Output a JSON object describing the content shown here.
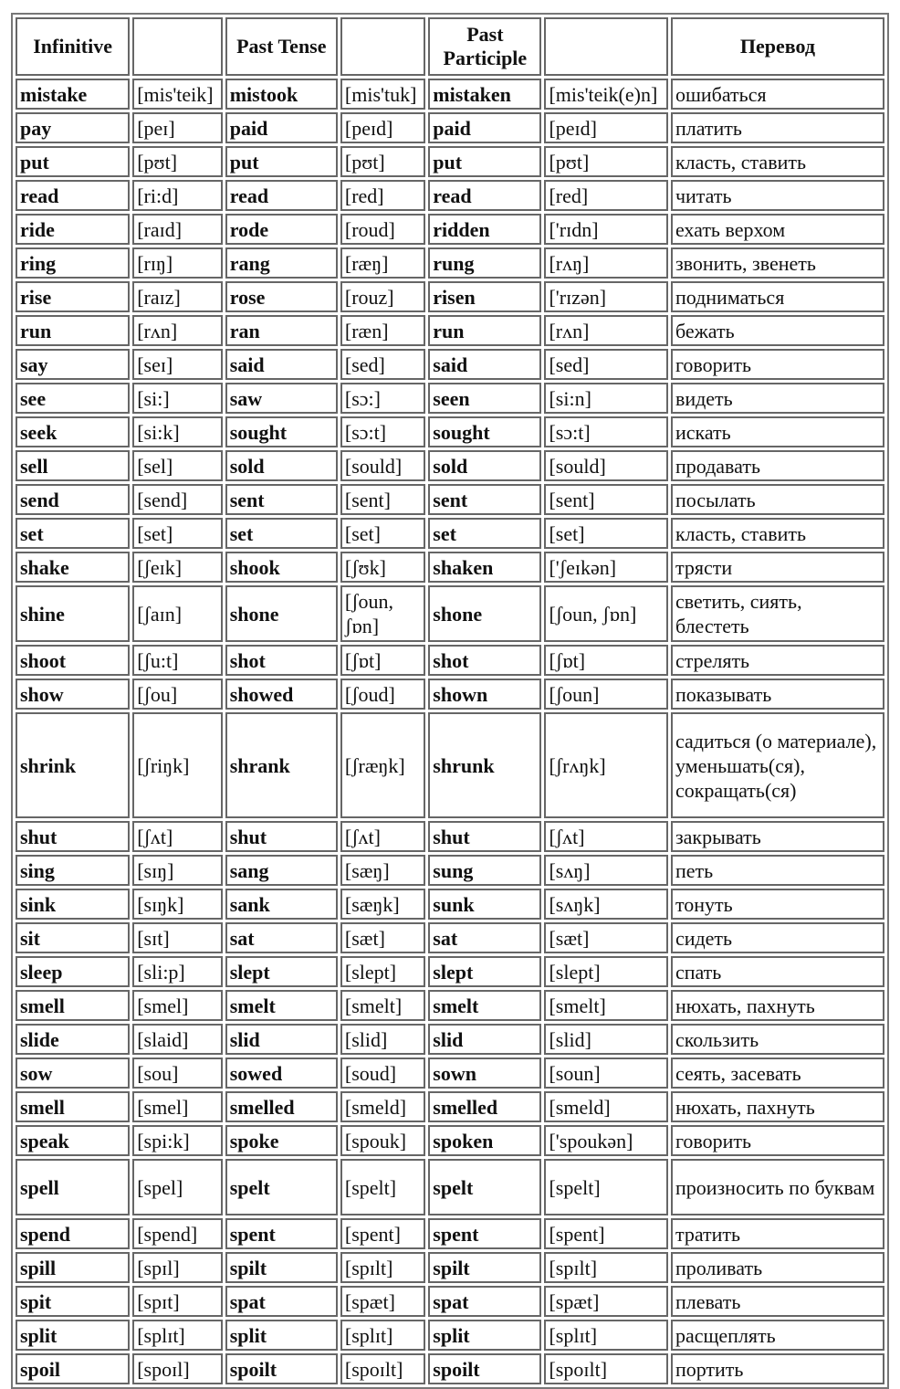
{
  "headers": [
    "Infinitive",
    "",
    "Past Tense",
    "",
    "Past Participle",
    "",
    "Перевод"
  ],
  "rows": [
    [
      "mistake",
      "[mis'teik]",
      "mistook",
      "[mis'tuk]",
      "mistaken",
      "[mis'teik(e)n]",
      "ошибаться"
    ],
    [
      "pay",
      "[peɪ]",
      "paid",
      "[peɪd]",
      "paid",
      "[peɪd]",
      "платить"
    ],
    [
      "put",
      "[pʊt]",
      "put",
      "[pʊt]",
      "put",
      "[pʊt]",
      "класть, ставить"
    ],
    [
      "read",
      "[ri:d]",
      "read",
      "[red]",
      "read",
      "[red]",
      "читать"
    ],
    [
      "ride",
      "[raɪd]",
      "rode",
      "[roud]",
      "ridden",
      "['rɪdn]",
      "ехать верхом"
    ],
    [
      "ring",
      "[rɪŋ]",
      "rang",
      "[ræŋ]",
      "rung",
      "[rʌŋ]",
      "звонить, звенеть"
    ],
    [
      "rise",
      "[raɪz]",
      "rose",
      "[rouz]",
      "risen",
      "['rɪzən]",
      "подниматься"
    ],
    [
      "run",
      "[rʌn]",
      "ran",
      "[ræn]",
      "run",
      "[rʌn]",
      "бежать"
    ],
    [
      "say",
      "[seɪ]",
      "said",
      "[sed]",
      "said",
      "[sed]",
      "говорить"
    ],
    [
      "see",
      "[si:]",
      "saw",
      "[sɔ:]",
      "seen",
      "[si:n]",
      "видеть"
    ],
    [
      "seek",
      "[si:k]",
      "sought",
      "[sɔ:t]",
      "sought",
      "[sɔ:t]",
      "искать"
    ],
    [
      "sell",
      "[sel]",
      "sold",
      "[sould]",
      "sold",
      "[sould]",
      "продавать"
    ],
    [
      "send",
      "[send]",
      "sent",
      "[sent]",
      "sent",
      "[sent]",
      "посылать"
    ],
    [
      "set",
      "[set]",
      "set",
      "[set]",
      "set",
      "[set]",
      "класть, ставить"
    ],
    [
      "shake",
      "[ʃeɪk]",
      "shook",
      "[ʃʊk]",
      "shaken",
      "['ʃeɪkən]",
      "трясти"
    ],
    [
      "shine",
      "[ʃaɪn]",
      "shone",
      "[ʃoun, ʃɒn]",
      "shone",
      "[ʃoun, ʃɒn]",
      "светить, сиять, блестеть"
    ],
    [
      "shoot",
      "[ʃu:t]",
      "shot",
      "[ʃɒt]",
      "shot",
      "[ʃɒt]",
      "стрелять"
    ],
    [
      "show",
      "[ʃou]",
      "showed",
      "[ʃoud]",
      "shown",
      "[ʃoun]",
      "показывать"
    ],
    [
      "shrink",
      "[ʃriŋk]",
      "shrank",
      "[ʃræŋk]",
      "shrunk",
      "[ʃrʌŋk]",
      "садиться (о материале), уменьшать(ся), сокращать(ся)"
    ],
    [
      "shut",
      "[ʃʌt]",
      "shut",
      "[ʃʌt]",
      "shut",
      "[ʃʌt]",
      "закрывать"
    ],
    [
      "sing",
      "[sɪŋ]",
      "sang",
      "[sæŋ]",
      "sung",
      "[sʌŋ]",
      "петь"
    ],
    [
      "sink",
      "[sɪŋk]",
      "sank",
      "[sæŋk]",
      "sunk",
      "[sʌŋk]",
      "тонуть"
    ],
    [
      "sit",
      "[sɪt]",
      "sat",
      "[sæt]",
      "sat",
      "[sæt]",
      "сидеть"
    ],
    [
      "sleep",
      "[sli:p]",
      "slept",
      "[slept]",
      "slept",
      "[slept]",
      "спать"
    ],
    [
      "smell",
      "[smel]",
      "smelt",
      "[smelt]",
      "smelt",
      "[smelt]",
      "нюхать, пахнуть"
    ],
    [
      "slide",
      "[slaid]",
      "slid",
      "[slid]",
      "slid",
      "[slid]",
      "скользить"
    ],
    [
      "sow",
      "[sou]",
      "sowed",
      "[soud]",
      "sown",
      "[soun]",
      "сеять, засевать"
    ],
    [
      "smell",
      "[smel]",
      "smelled",
      "[smeld]",
      "smelled",
      "[smeld]",
      "нюхать, пахнуть"
    ],
    [
      "speak",
      "[spi:k]",
      "spoke",
      "[spouk]",
      "spoken",
      "['spoukən]",
      "говорить"
    ],
    [
      "spell",
      "[spel]",
      "spelt",
      "[spelt]",
      "spelt",
      "[spelt]",
      "произносить по буквам"
    ],
    [
      "spend",
      "[spend]",
      "spent",
      "[spent]",
      "spent",
      "[spent]",
      "тратить"
    ],
    [
      "spill",
      "[spɪl]",
      "spilt",
      "[spɪlt]",
      "spilt",
      "[spɪlt]",
      "проливать"
    ],
    [
      "spit",
      "[spɪt]",
      "spat",
      "[spæt]",
      "spat",
      "[spæt]",
      "плевать"
    ],
    [
      "split",
      "[splɪt]",
      "split",
      "[splɪt]",
      "split",
      "[splɪt]",
      "расщеплять"
    ],
    [
      "spoil",
      "[spoɪl]",
      "spoilt",
      "[spoɪlt]",
      "spoilt",
      "[spoɪlt]",
      "портить"
    ]
  ]
}
